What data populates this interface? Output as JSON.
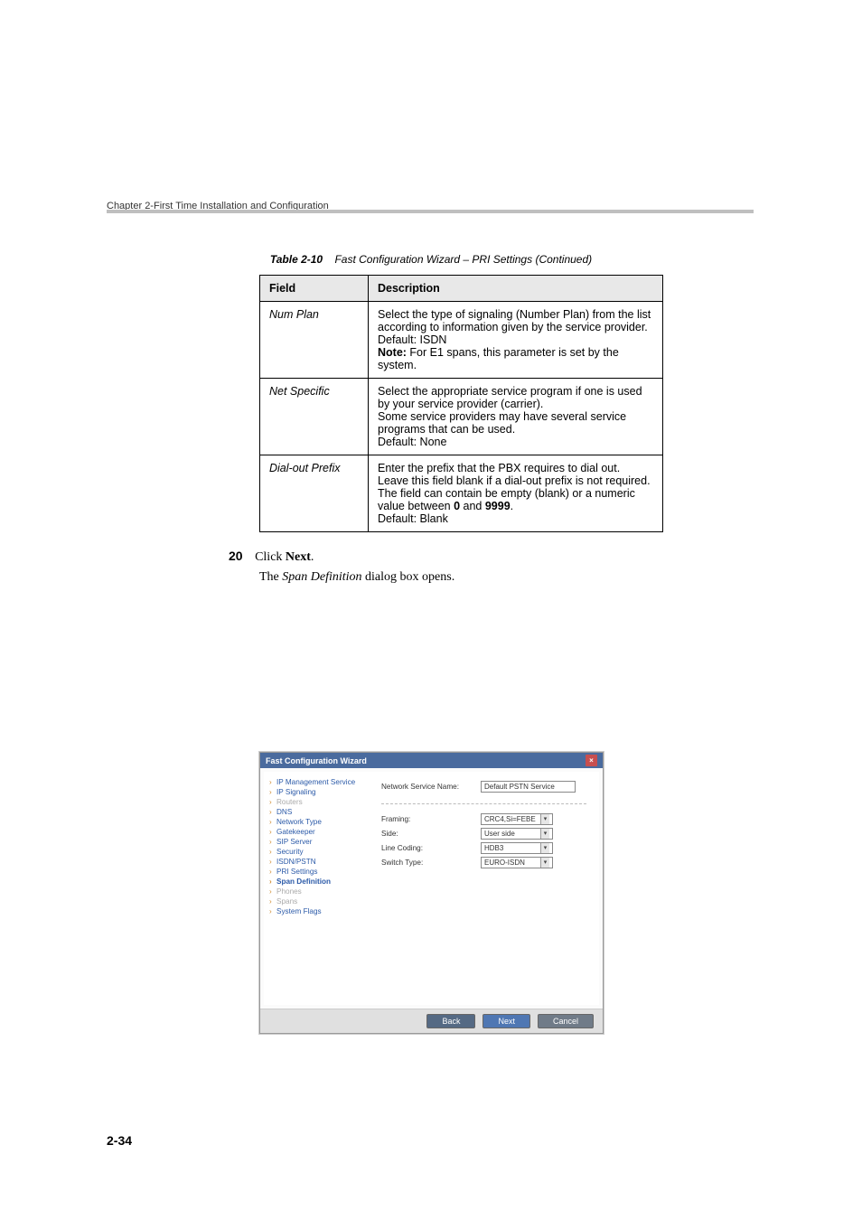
{
  "header": {
    "text": "Chapter 2-First Time Installation and Configuration"
  },
  "table_caption": {
    "num": "Table 2-10",
    "text": "Fast Configuration Wizard – PRI Settings (Continued)"
  },
  "table": {
    "headers": {
      "field": "Field",
      "desc": "Description"
    },
    "rows": [
      {
        "field": "Num Plan",
        "p1": "Select the type of signaling (Number Plan) from the list according to information given by the service provider.",
        "p2": "Default: ISDN",
        "note_label": "Note:",
        "note_text": " For E1 spans, this parameter is set by the system."
      },
      {
        "field": "Net Specific",
        "p1": "Select the appropriate service program if one is used by your service provider (carrier).",
        "p2": "Some service providers may have several service programs that can be used.",
        "p3": "Default: None"
      },
      {
        "field": "Dial-out Prefix",
        "p1": "Enter the prefix that the PBX requires to dial out. Leave this field blank if a dial-out prefix is not required.",
        "p2a": "The field can contain be empty (blank) or a numeric value between ",
        "b0": "0",
        "p2b": " and ",
        "b9": "9999",
        "p2c": ".",
        "p3": "Default: Blank"
      }
    ]
  },
  "step": {
    "num": "20",
    "click": "Click ",
    "next": "Next",
    "dot": "."
  },
  "step_desc": {
    "pre": "The ",
    "name": "Span Definition",
    "post": " dialog box opens."
  },
  "wizard": {
    "title": "Fast Configuration Wizard",
    "close": "×",
    "nav": [
      {
        "label": "IP Management Service",
        "cls": ""
      },
      {
        "label": "IP Signaling",
        "cls": ""
      },
      {
        "label": "Routers",
        "cls": "gray"
      },
      {
        "label": "DNS",
        "cls": ""
      },
      {
        "label": "Network Type",
        "cls": ""
      },
      {
        "label": "Gatekeeper",
        "cls": ""
      },
      {
        "label": "SIP Server",
        "cls": ""
      },
      {
        "label": "Security",
        "cls": ""
      },
      {
        "label": "ISDN/PSTN",
        "cls": ""
      },
      {
        "label": "PRI Settings",
        "cls": ""
      },
      {
        "label": "Span Definition",
        "cls": "bold"
      },
      {
        "label": "Phones",
        "cls": "gray"
      },
      {
        "label": "Spans",
        "cls": "gray"
      },
      {
        "label": "System Flags",
        "cls": ""
      }
    ],
    "fields": {
      "nsn_label": "Network Service Name:",
      "nsn_value": "Default PSTN Service",
      "framing_label": "Framing:",
      "framing_value": "CRC4,Si=FEBE",
      "side_label": "Side:",
      "side_value": "User side",
      "line_label": "Line Coding:",
      "line_value": "HDB3",
      "switch_label": "Switch Type:",
      "switch_value": "EURO-ISDN"
    },
    "buttons": {
      "back": "Back",
      "next": "Next",
      "cancel": "Cancel"
    }
  },
  "page_num": "2-34"
}
